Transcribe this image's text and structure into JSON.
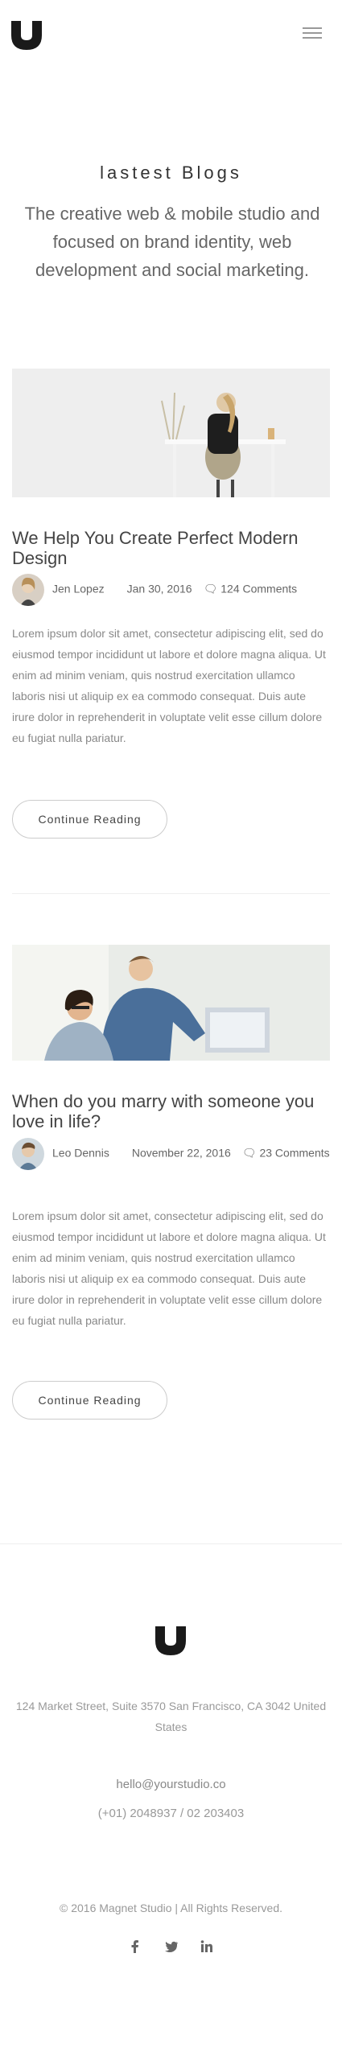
{
  "header": {
    "logo_name": "studio-logo",
    "menu_icon": "hamburger-icon"
  },
  "intro": {
    "title": "lastest Blogs",
    "subtitle": "The creative web & mobile studio and focused on brand identity, web development and social marketing."
  },
  "posts": [
    {
      "title": "We Help You Create Perfect Modern Design",
      "author": "Jen Lopez",
      "date": "Jan 30, 2016",
      "comments": "124 Comments",
      "body": "Lorem ipsum dolor sit amet, consectetur adipiscing elit, sed do eiusmod tempor incididunt ut labore et dolore magna aliqua. Ut enim ad minim veniam, quis nostrud exercitation ullamco laboris nisi ut aliquip ex ea commodo consequat. Duis aute irure dolor in reprehenderit in voluptate velit esse cillum dolore eu fugiat nulla pariatur.",
      "button": "Continue Reading"
    },
    {
      "title": "When do you marry with someone you love in life?",
      "author": "Leo Dennis",
      "date": "November 22, 2016",
      "comments": "23 Comments",
      "body": "Lorem ipsum dolor sit amet, consectetur adipiscing elit, sed do eiusmod tempor incididunt ut labore et dolore magna aliqua. Ut enim ad minim veniam, quis nostrud exercitation ullamco laboris nisi ut aliquip ex ea commodo consequat. Duis aute irure dolor in reprehenderit in voluptate velit esse cillum dolore eu fugiat nulla pariatur.",
      "button": "Continue Reading"
    }
  ],
  "footer": {
    "address": "124 Market Street, Suite 3570 San Francisco, CA 3042 United States",
    "email": "hello@yourstudio.co",
    "phone": "(+01) 2048937 / 02 203403",
    "copyright": "© 2016 Magnet Studio | All Rights Reserved.",
    "socials": [
      "facebook-icon",
      "twitter-icon",
      "linkedin-icon"
    ]
  },
  "colors": {
    "text_dark": "#333333",
    "text_body": "#888888",
    "border": "#cccccc"
  }
}
